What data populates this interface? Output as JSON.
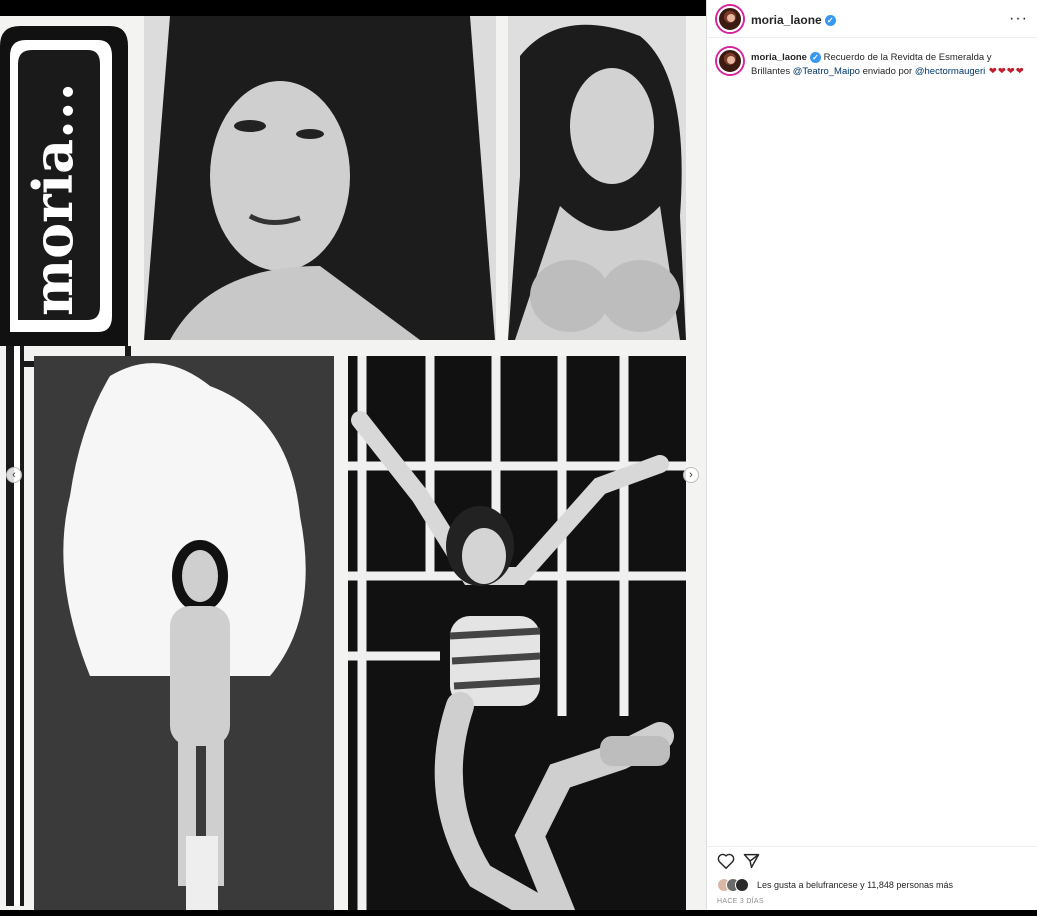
{
  "post": {
    "username": "moria_laone",
    "verified_glyph": "✓",
    "more_glyph": "···",
    "media_text": "moria...",
    "caption": {
      "username": "moria_laone",
      "text_before": " Recuerdo de la Revidta de Esmeralda y Brillantes ",
      "mention_1": "@Teatro_Maipo",
      "text_middle": " enviado por ",
      "mention_2": "@hectormaugeri",
      "hearts": " ❤❤❤❤"
    },
    "likes_text": "Les gusta a belufrancese y 11,848 personas más",
    "time_text": "HACE 3 DÍAS",
    "carousel_prev_glyph": "‹",
    "carousel_next_glyph": "›"
  },
  "icons": {
    "like": "heart-icon",
    "share": "paper-plane-icon",
    "more": "more-options-icon"
  },
  "colors": {
    "accent_blue": "#3897f0",
    "mention": "#00376b",
    "heart": "#c0202e",
    "ring": "#d6249f"
  }
}
